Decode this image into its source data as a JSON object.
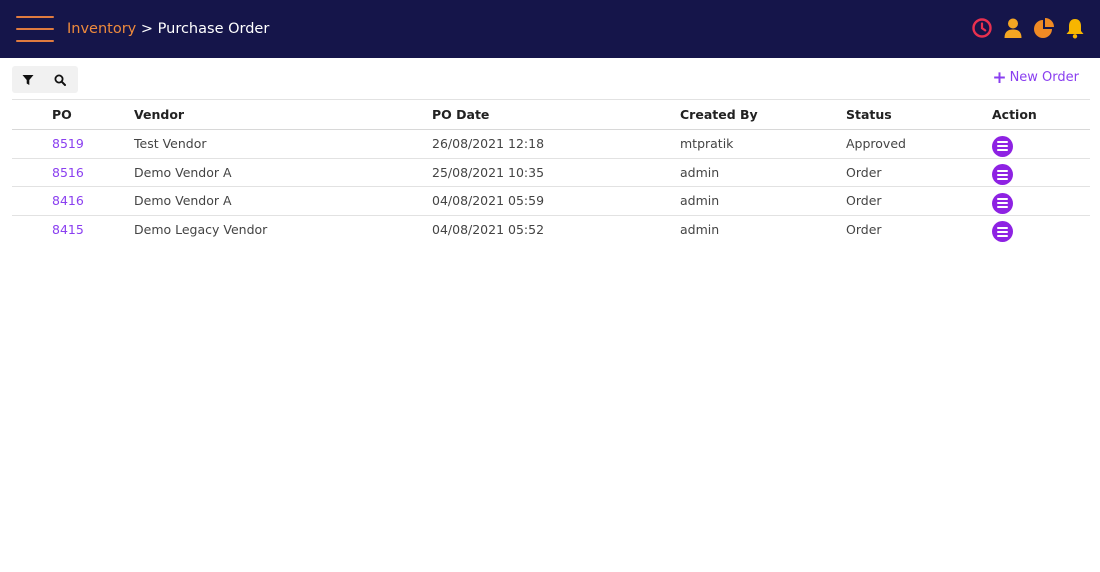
{
  "header": {
    "breadcrumb_link": "Inventory",
    "breadcrumb_separator": " > ",
    "breadcrumb_current": "Purchase Order",
    "icons": [
      "clock-icon",
      "user-icon",
      "pie-chart-icon",
      "bell-icon"
    ],
    "colors": {
      "bar": "#15154a",
      "accent": "#ee8a3c",
      "clock": "#e8304f",
      "user": "#f5a623",
      "chart": "#f08a24",
      "bell": "#f7b500"
    }
  },
  "toolbar": {
    "icons": [
      "filter-icon",
      "search-icon"
    ],
    "new_order_label": "New Order"
  },
  "table": {
    "columns": [
      "PO",
      "Vendor",
      "PO Date",
      "Created By",
      "Status",
      "Action"
    ],
    "rows": [
      {
        "po": "8519",
        "vendor": "Test Vendor",
        "date": "26/08/2021 12:18",
        "created_by": "mtpratik",
        "status": "Approved"
      },
      {
        "po": "8516",
        "vendor": "Demo Vendor A",
        "date": "25/08/2021 10:35",
        "created_by": "admin",
        "status": "Order"
      },
      {
        "po": "8416",
        "vendor": "Demo Vendor A",
        "date": "04/08/2021 05:59",
        "created_by": "admin",
        "status": "Order"
      },
      {
        "po": "8415",
        "vendor": "Demo Legacy Vendor",
        "date": "04/08/2021 05:52",
        "created_by": "admin",
        "status": "Order"
      }
    ],
    "link_color": "#8a3ff0",
    "action_color": "#8e22e3"
  }
}
